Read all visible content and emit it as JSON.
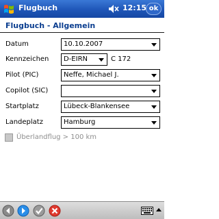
{
  "titlebar": {
    "app_title": "Flugbuch",
    "clock": "12:15",
    "close_label": "ok",
    "start_icon": "windows-flag-icon",
    "volume_icon": "speaker-icon"
  },
  "page": {
    "header": "Flugbuch - Allgemein"
  },
  "form": {
    "datum": {
      "label": "Datum",
      "value": "10.10.2007"
    },
    "kennzeichen": {
      "label": "Kennzeichen",
      "value": "D-EIRN",
      "aircraft_type": "C 172"
    },
    "pilot": {
      "label": "Pilot (PIC)",
      "value": "Neffe, Michael J."
    },
    "copilot": {
      "label": "Copilot (SIC)",
      "value": ""
    },
    "startplatz": {
      "label": "Startplatz",
      "value": "Lübeck-Blankensee"
    },
    "landeplatz": {
      "label": "Landeplatz",
      "value": "Hamburg"
    },
    "ueberlandflug": {
      "label": "Überlandflug > 100 km",
      "checked": false,
      "enabled": false
    }
  },
  "cmdbar": {
    "icons": [
      "back-icon",
      "forward-icon",
      "ok-check-icon",
      "cancel-icon",
      "keyboard-icon"
    ]
  },
  "colors": {
    "titlebar": "#1f56b8",
    "header_text": "#0a3d8f",
    "disabled_text": "#8e8e8e"
  }
}
